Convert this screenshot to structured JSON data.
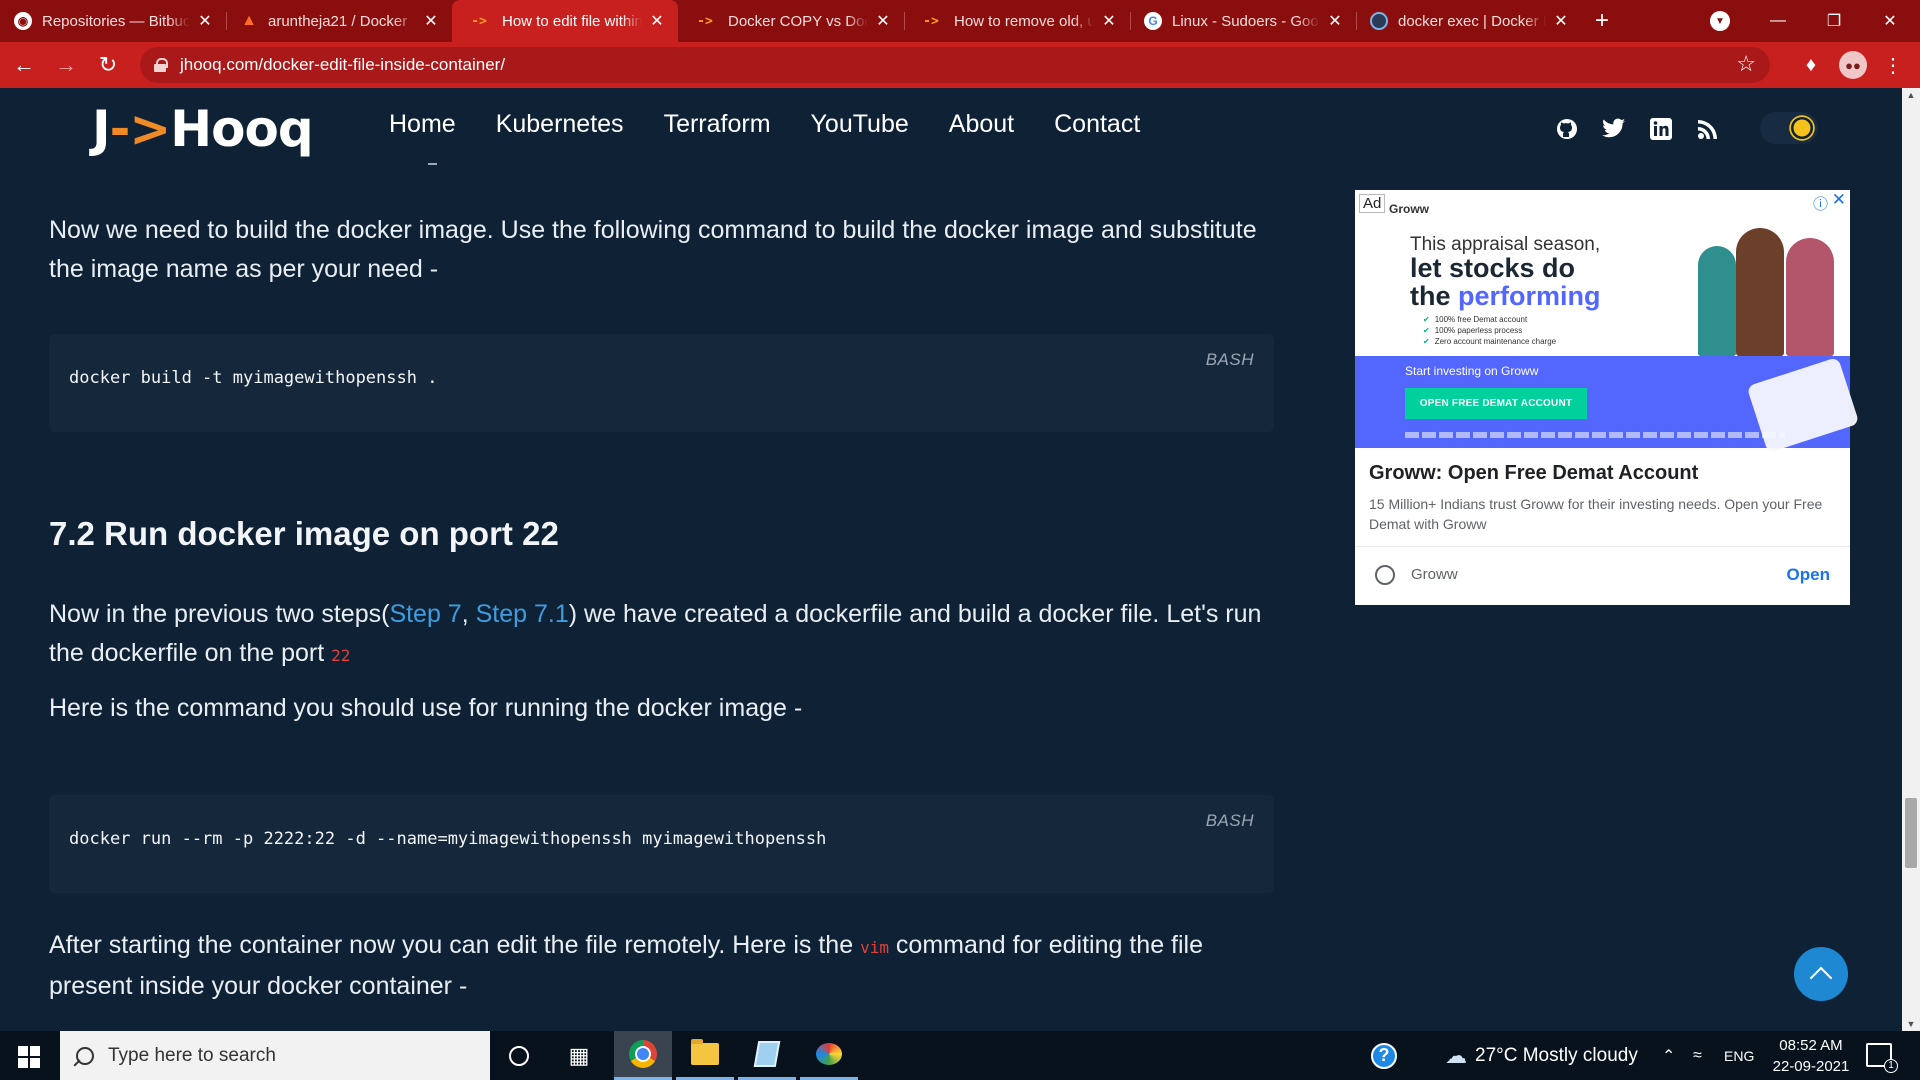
{
  "browser": {
    "tabs": [
      {
        "title": "Repositories — Bitbucket",
        "favicon": "bitbucket-icon"
      },
      {
        "title": "aruntheja21 / Docker",
        "favicon": "gitlab-icon"
      },
      {
        "title": "How to edit file within",
        "favicon": "jhooq-icon",
        "active": true
      },
      {
        "title": "Docker COPY vs Docker",
        "favicon": "jhooq-icon"
      },
      {
        "title": "How to remove old, un",
        "favicon": "jhooq-icon"
      },
      {
        "title": "Linux - Sudoers - Goo",
        "favicon": "google-icon"
      },
      {
        "title": "docker exec | Docker D",
        "favicon": "docker-icon"
      }
    ],
    "url": "jhooq.com/docker-edit-file-inside-container/",
    "accent": "#c8201f"
  },
  "site": {
    "logo_prefix": "J",
    "logo_arrow": "->",
    "logo_suffix": "Hooq",
    "nav": [
      "Home",
      "Kubernetes",
      "Terraform",
      "YouTube",
      "About",
      "Contact"
    ],
    "social": [
      "github-icon",
      "twitter-icon",
      "linkedin-icon",
      "rss-icon"
    ],
    "theme": "dark"
  },
  "article": {
    "p1": "Now we need to build the docker image. Use the following command to build the docker image and substitute the image name as per your need -",
    "code1": {
      "lang": "BASH",
      "command": "docker build -t myimagewithopenssh ."
    },
    "heading": "7.2 Run docker image on port 22",
    "p2": {
      "before": "Now in the previous two steps(",
      "link1": "Step 7",
      "sep": ", ",
      "link2": "Step 7.1",
      "after": ") we have created a dockerfile and build a docker file. Let's run the dockerfile on the port ",
      "code": "22"
    },
    "p3": "Here is the command you should use for running the docker image -",
    "code2": {
      "lang": "BASH",
      "command": "docker run --rm -p 2222:22 -d --name=myimagewithopenssh myimagewithopenssh"
    },
    "p4": {
      "before": "After starting the container now you can edit the file remotely. Here is the ",
      "code": "vim",
      "after": " command for editing the file present inside your docker container -"
    }
  },
  "ad": {
    "badge": "Ad",
    "brand_small": "Groww",
    "line1": "This appraisal season,",
    "line2a": "let stocks do",
    "line2b_plain": "the ",
    "line2b_hl": "performing",
    "bullets": [
      "100% free Demat account",
      "100% paperless process",
      "Zero account maintenance charge"
    ],
    "start_text": "Start investing on Groww",
    "cta": "OPEN FREE DEMAT ACCOUNT",
    "title": "Groww: Open Free Demat Account",
    "description": "15 Million+ Indians trust Groww for their investing needs. Open your Free Demat with Groww",
    "advertiser": "Groww",
    "open_label": "Open"
  },
  "taskbar": {
    "search_placeholder": "Type here to search",
    "weather": "27°C  Mostly cloudy",
    "language": "ENG",
    "time": "08:52 AM",
    "date": "22-09-2021",
    "notifications": "1"
  }
}
